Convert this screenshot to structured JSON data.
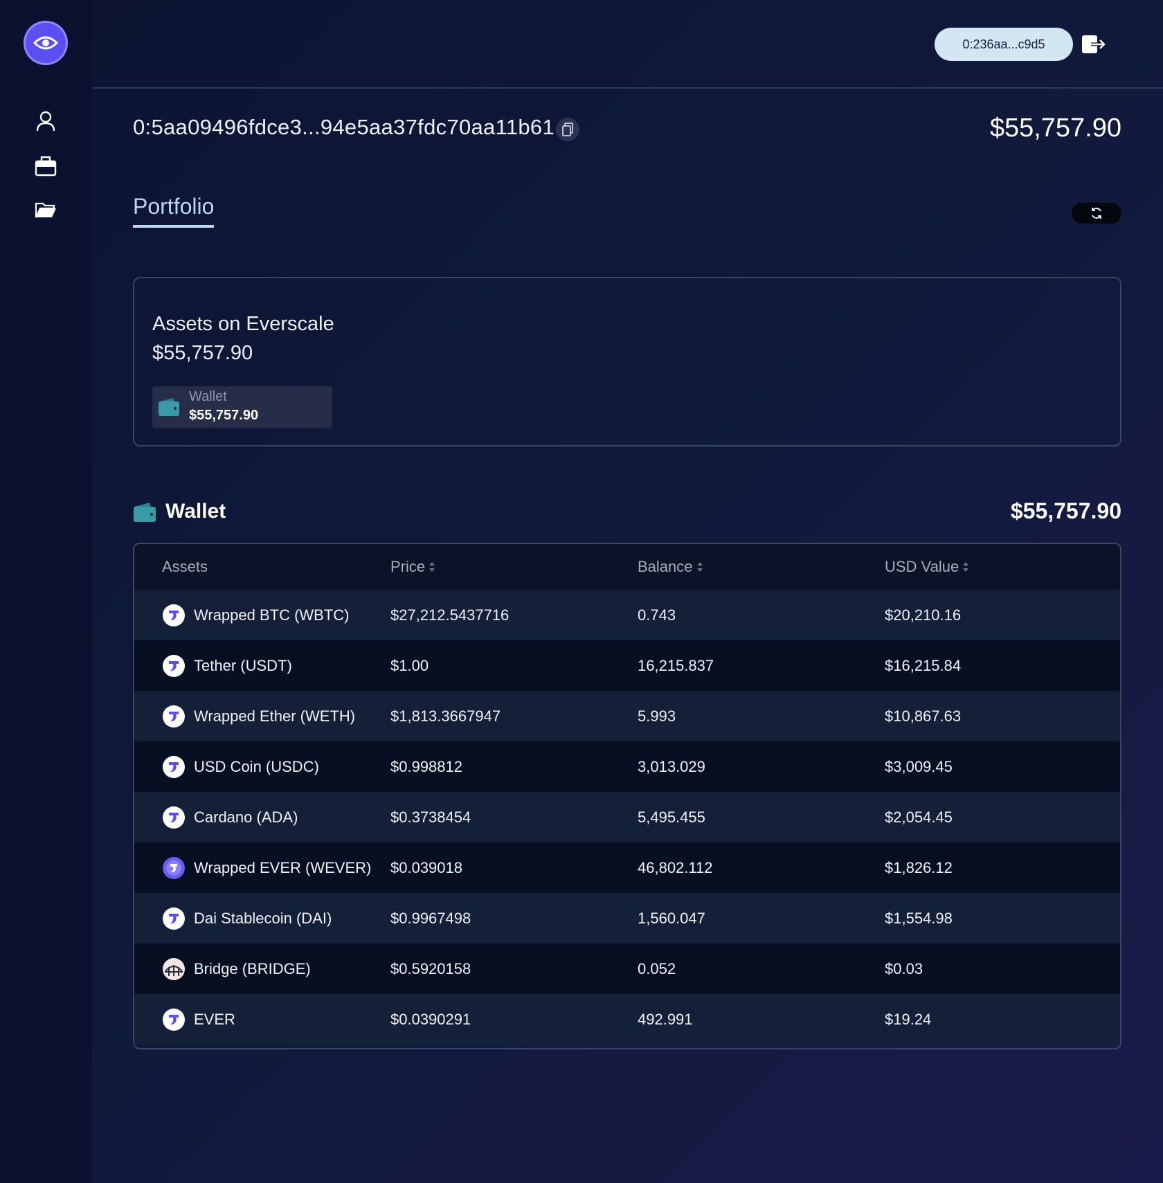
{
  "sidebar": {
    "logo": "eye-icon",
    "items": [
      {
        "icon": "user-icon"
      },
      {
        "icon": "briefcase-icon"
      },
      {
        "icon": "folder-icon"
      }
    ]
  },
  "topbar": {
    "account_address": "0:236aa...c9d5",
    "logout_icon": "logout-icon"
  },
  "header": {
    "address": "0:5aa09496fdce3...94e5aa37fdc70aa11b61",
    "total": "$55,757.90"
  },
  "tabs": [
    {
      "label": "Portfolio",
      "active": true
    }
  ],
  "assets_card": {
    "title": "Assets on Everscale",
    "total": "$55,757.90",
    "chip_label": "Wallet",
    "chip_value": "$55,757.90"
  },
  "wallet": {
    "title": "Wallet",
    "total": "$55,757.90",
    "columns": {
      "assets": "Assets",
      "price": "Price",
      "balance": "Balance",
      "usd": "USD Value"
    },
    "rows": [
      {
        "name": "Wrapped BTC (WBTC)",
        "price": "$27,212.5437716",
        "balance": "0.743",
        "usd": "$20,210.16",
        "icon": "octus"
      },
      {
        "name": "Tether (USDT)",
        "price": "$1.00",
        "balance": "16,215.837",
        "usd": "$16,215.84",
        "icon": "octus"
      },
      {
        "name": "Wrapped Ether (WETH)",
        "price": "$1,813.3667947",
        "balance": "5.993",
        "usd": "$10,867.63",
        "icon": "octus"
      },
      {
        "name": "USD Coin (USDC)",
        "price": "$0.998812",
        "balance": "3,013.029",
        "usd": "$3,009.45",
        "icon": "octus"
      },
      {
        "name": "Cardano (ADA)",
        "price": "$0.3738454",
        "balance": "5,495.455",
        "usd": "$2,054.45",
        "icon": "octus"
      },
      {
        "name": "Wrapped EVER (WEVER)",
        "price": "$0.039018",
        "balance": "46,802.112",
        "usd": "$1,826.12",
        "icon": "wever"
      },
      {
        "name": "Dai Stablecoin (DAI)",
        "price": "$0.9967498",
        "balance": "1,560.047",
        "usd": "$1,554.98",
        "icon": "octus"
      },
      {
        "name": "Bridge (BRIDGE)",
        "price": "$0.5920158",
        "balance": "0.052",
        "usd": "$0.03",
        "icon": "bridge"
      },
      {
        "name": "EVER",
        "price": "$0.0390291",
        "balance": "492.991",
        "usd": "$19.24",
        "icon": "octus"
      }
    ]
  },
  "colors": {
    "accent": "#5a4ff0",
    "pill_bg": "#d3e6f4",
    "tab_active": "#bcd6f0",
    "wallet_icon": "#3a9aa8"
  }
}
